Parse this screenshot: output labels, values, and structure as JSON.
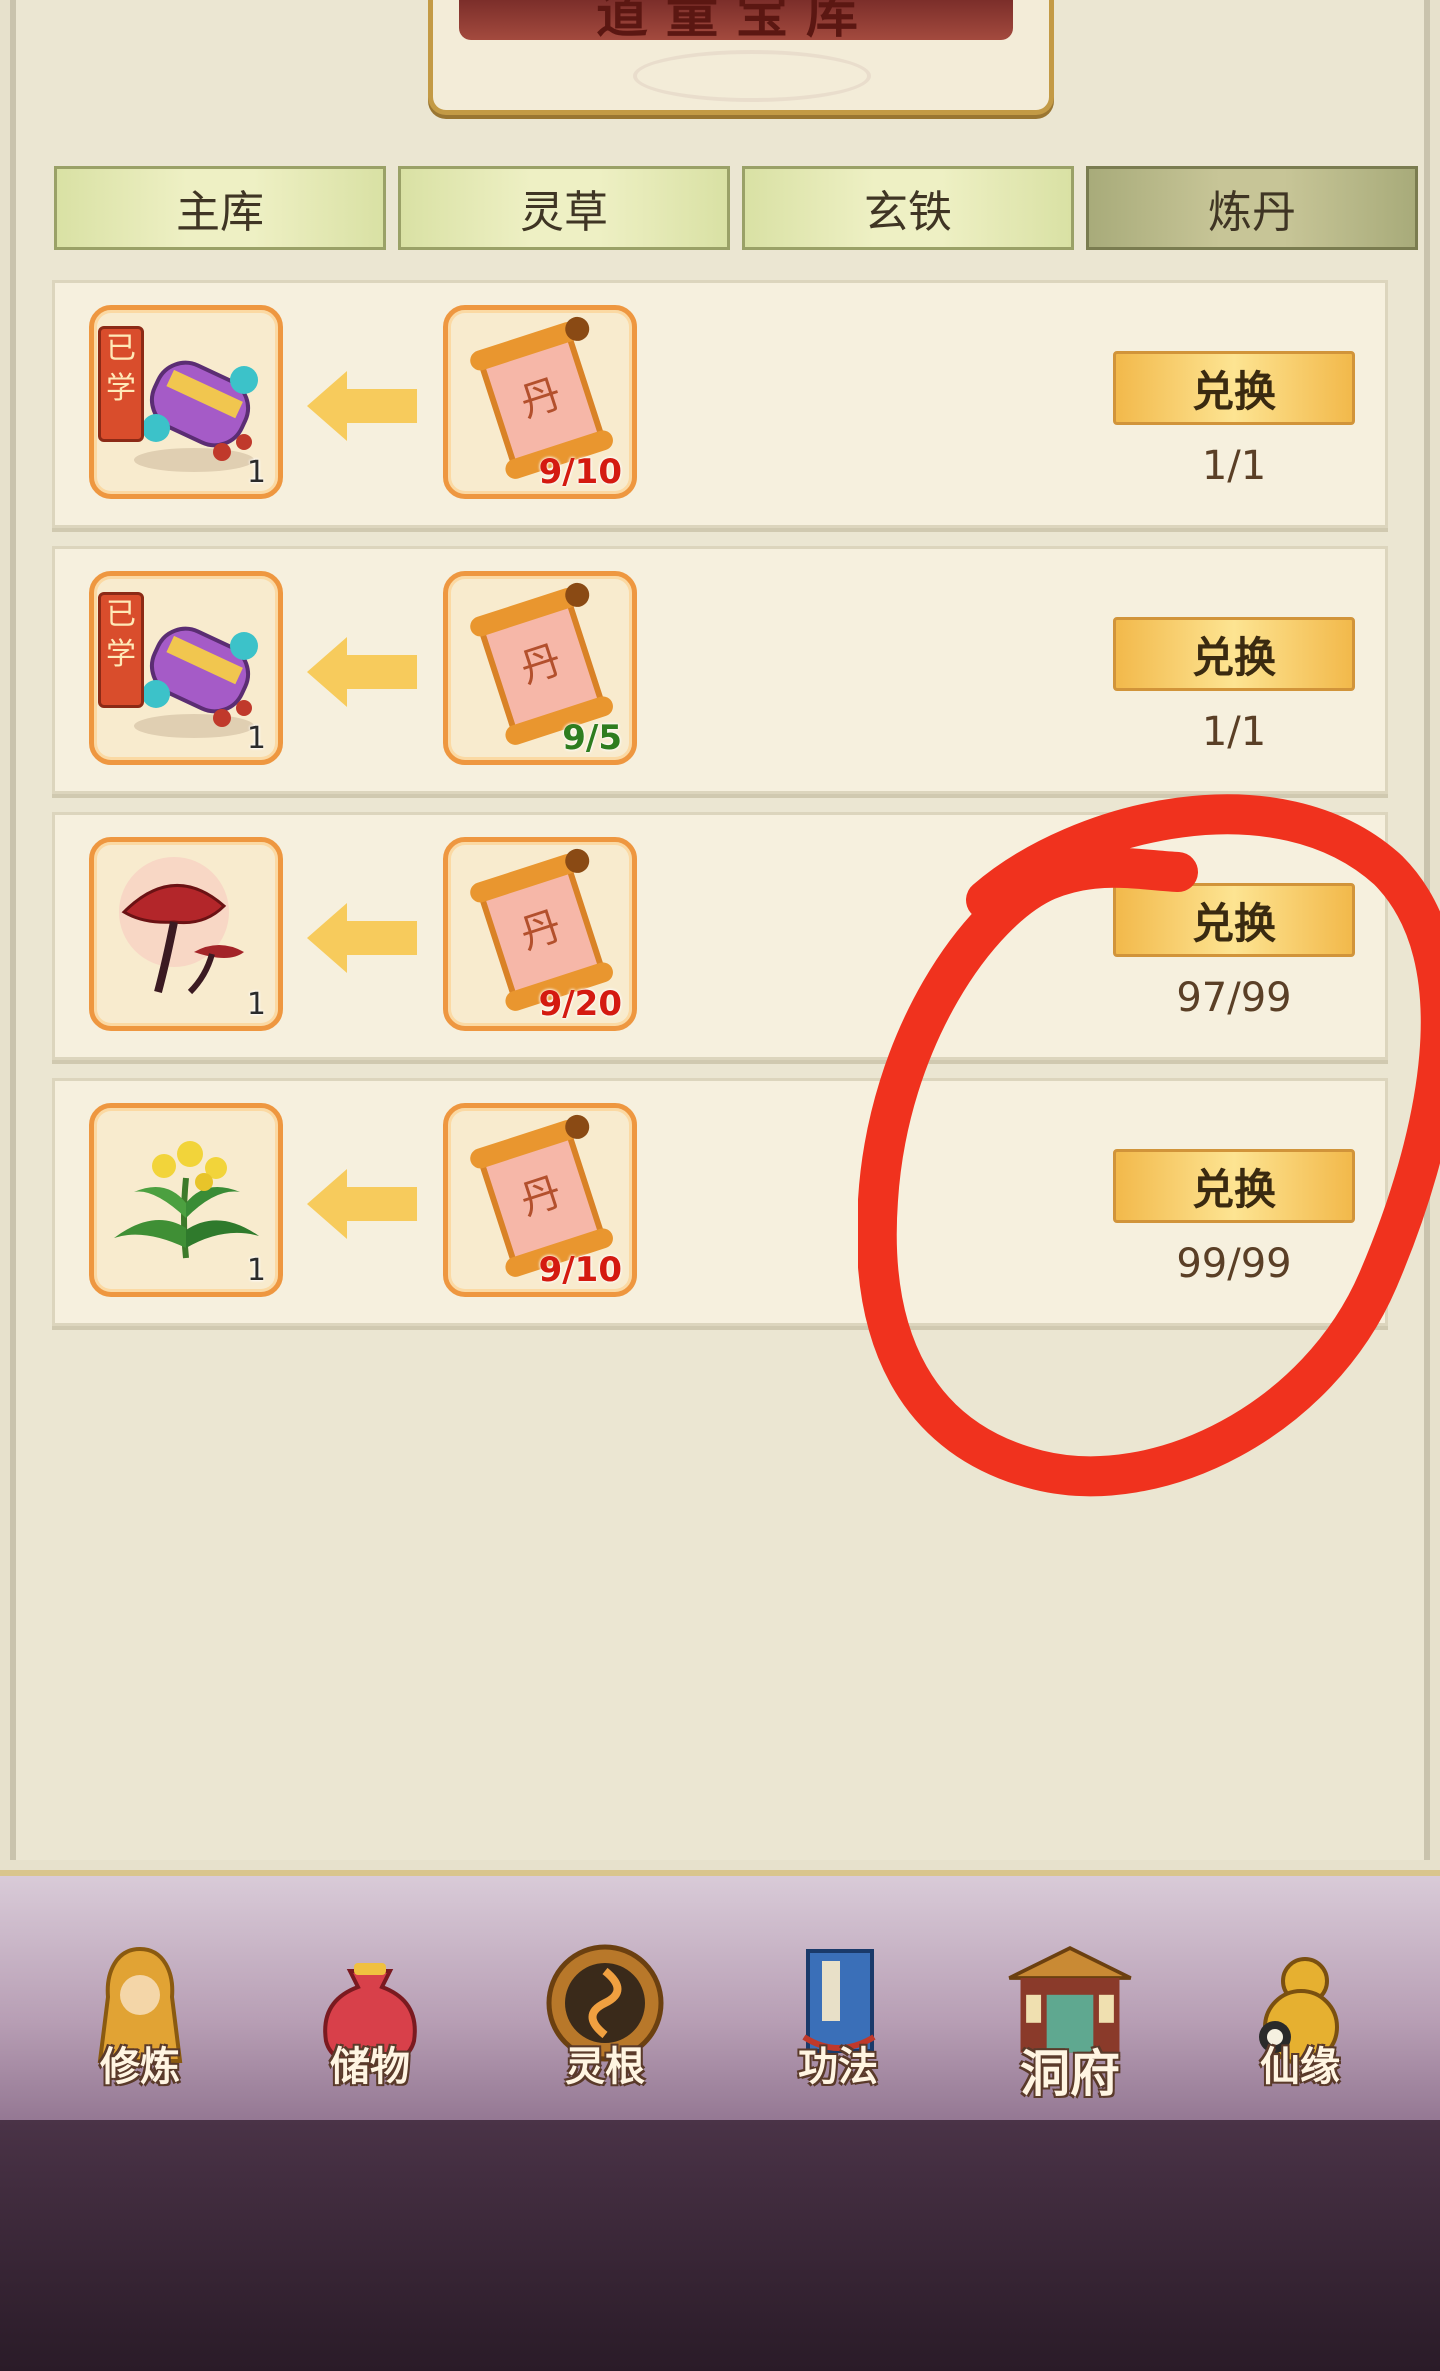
{
  "title": "道童宝库",
  "tabs": [
    {
      "label": "主库",
      "active": false
    },
    {
      "label": "灵草",
      "active": false
    },
    {
      "label": "玄铁",
      "active": false
    },
    {
      "label": "炼丹",
      "active": true
    }
  ],
  "rows": [
    {
      "reward_icon": "gourd-icon",
      "reward_qty": "1",
      "learned_badge": "已学",
      "cost_icon": "pill-scroll-icon",
      "cost_count": "9/10",
      "cost_color": "#d41a10",
      "button_label": "兑换",
      "limit": "1/1"
    },
    {
      "reward_icon": "gourd-icon",
      "reward_qty": "1",
      "learned_badge": "已学",
      "cost_icon": "pill-scroll-icon",
      "cost_count": "9/5",
      "cost_color": "#2e7d1f",
      "button_label": "兑换",
      "limit": "1/1"
    },
    {
      "reward_icon": "lingzhi-icon",
      "reward_qty": "1",
      "learned_badge": "",
      "cost_icon": "pill-scroll-icon",
      "cost_count": "9/20",
      "cost_color": "#d41a10",
      "button_label": "兑换",
      "limit": "97/99"
    },
    {
      "reward_icon": "herb-icon",
      "reward_qty": "1",
      "learned_badge": "",
      "cost_icon": "pill-scroll-icon",
      "cost_count": "9/10",
      "cost_color": "#d41a10",
      "button_label": "兑换",
      "limit": "99/99"
    }
  ],
  "scroll_glyph": "丹",
  "bottom_nav": [
    {
      "label": "修炼",
      "icon": "meditating-figure-icon"
    },
    {
      "label": "储物",
      "icon": "storage-bag-icon"
    },
    {
      "label": "灵根",
      "icon": "spirit-root-icon"
    },
    {
      "label": "功法",
      "icon": "technique-book-icon"
    },
    {
      "label": "洞府",
      "icon": "cave-mansion-icon"
    },
    {
      "label": "仙缘",
      "icon": "immortal-gourd-icon"
    }
  ],
  "colors": {
    "annotation": "#f0321e",
    "accent_gold": "#f2b94b",
    "slot_border": "#ee9740"
  }
}
